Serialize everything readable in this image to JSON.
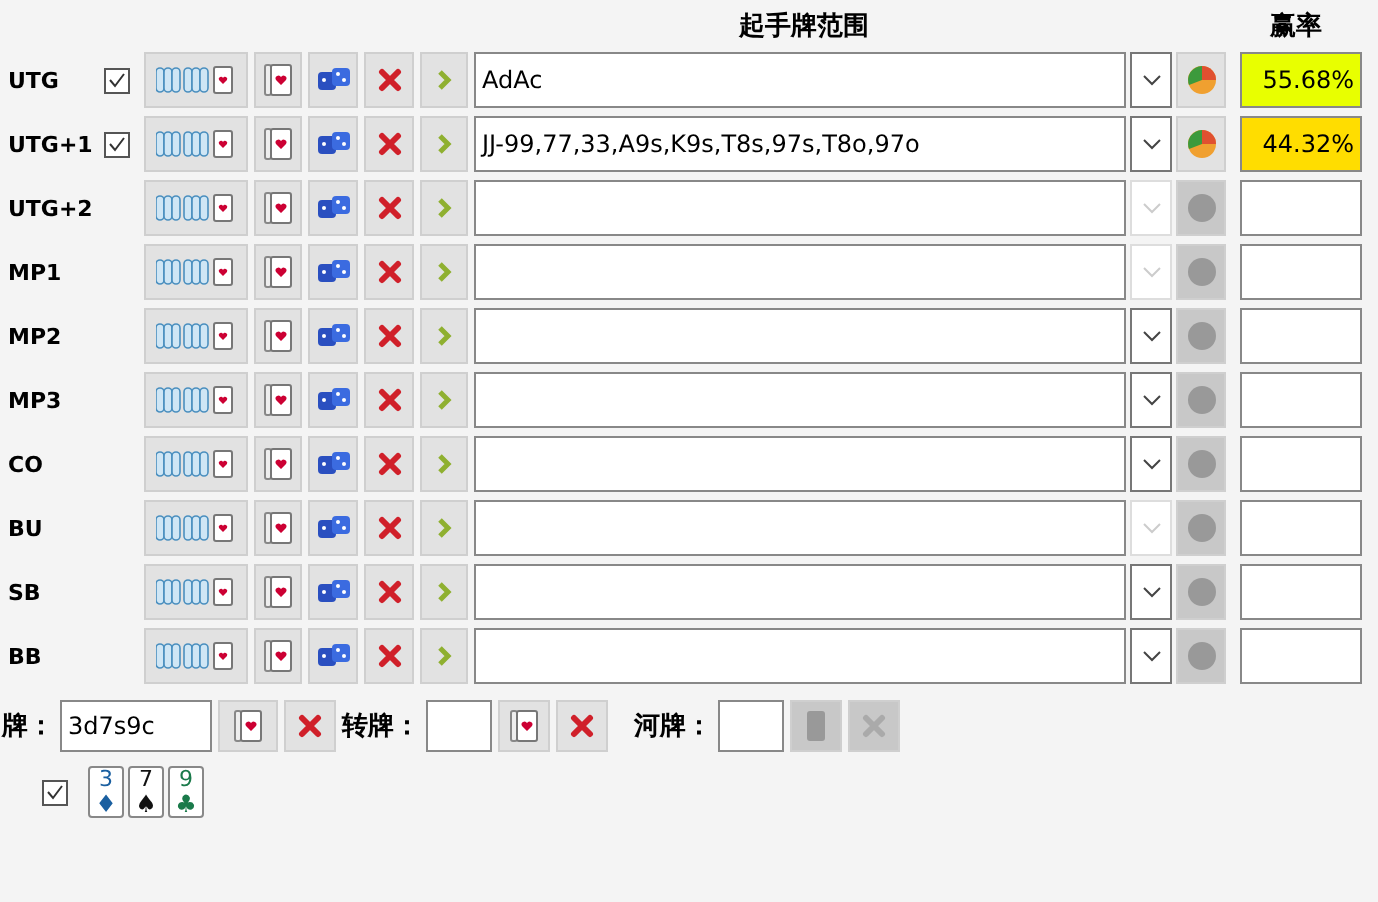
{
  "header": {
    "range_title": "起手牌范围",
    "equity_title": "赢率"
  },
  "players": [
    {
      "position": "UTG",
      "checked": true,
      "range": "AdAc",
      "dropdown_disabled": false,
      "chart_disabled": false,
      "equity": "55.68%",
      "color": "#e8ff00"
    },
    {
      "position": "UTG+1",
      "checked": true,
      "range": "JJ-99,77,33,A9s,K9s,T8s,97s,T8o,97o",
      "dropdown_disabled": false,
      "chart_disabled": false,
      "equity": "44.32%",
      "color": "#ffdd00"
    },
    {
      "position": "UTG+2",
      "dropdown_disabled": true,
      "chart_disabled": true
    },
    {
      "position": "MP1",
      "dropdown_disabled": true,
      "chart_disabled": true
    },
    {
      "position": "MP2",
      "dropdown_disabled": false,
      "chart_disabled": true
    },
    {
      "position": "MP3",
      "dropdown_disabled": false,
      "chart_disabled": true
    },
    {
      "position": "CO",
      "dropdown_disabled": false,
      "chart_disabled": true
    },
    {
      "position": "BU",
      "dropdown_disabled": true,
      "chart_disabled": true
    },
    {
      "position": "SB",
      "dropdown_disabled": false,
      "chart_disabled": true
    },
    {
      "position": "BB",
      "dropdown_disabled": false,
      "chart_disabled": true
    }
  ],
  "board": {
    "flop_label": "牌：",
    "flop_value": "3d7s9c",
    "turn_label": "转牌：",
    "river_label": "河牌：",
    "river_disabled": true,
    "show_cards": true,
    "cards": [
      {
        "rank": "3",
        "suit": "♦",
        "color": "#1a5fa0"
      },
      {
        "rank": "7",
        "suit": "♠",
        "color": "#111111"
      },
      {
        "rank": "9",
        "suit": "♣",
        "color": "#1a7a4a"
      }
    ]
  }
}
